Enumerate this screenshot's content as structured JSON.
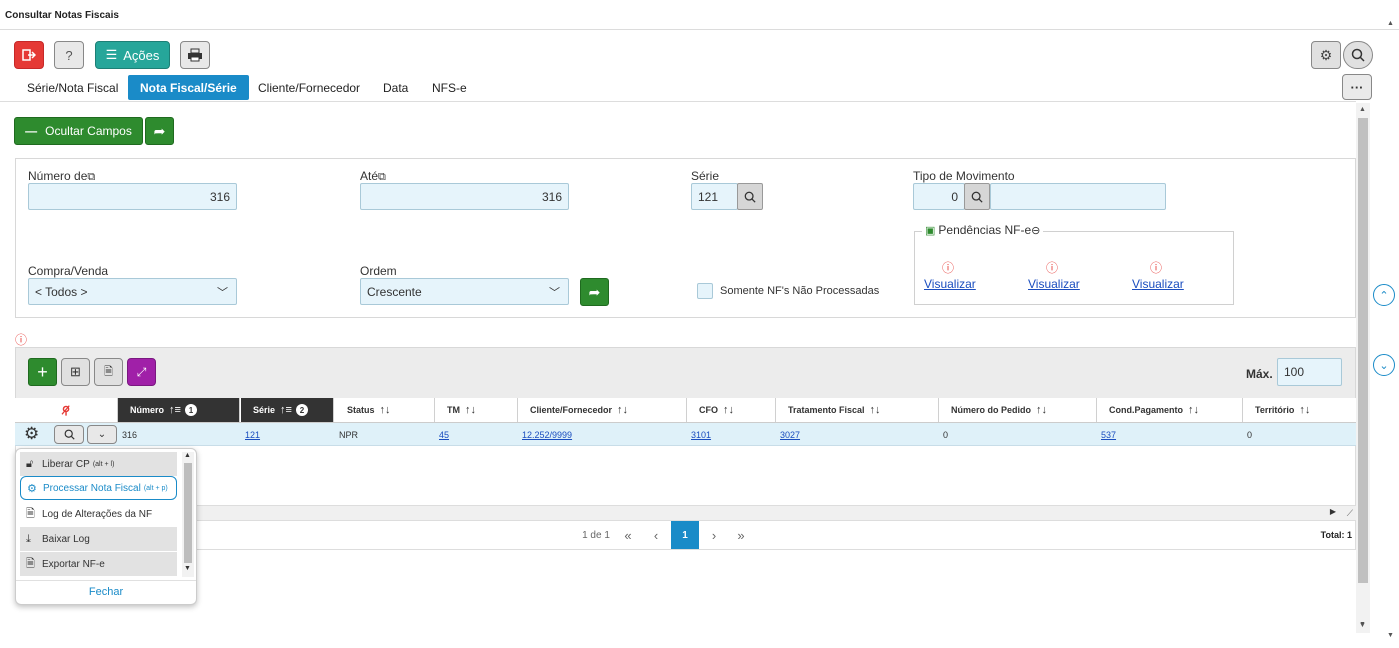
{
  "window": {
    "title": "Consultar Notas Fiscais"
  },
  "toolbar": {
    "exit_icon": "exit-icon",
    "help_label": "?",
    "actions_label": "Ações",
    "printer_icon": "printer-icon",
    "settings_icon": "gear-icon",
    "search_icon": "search-icon",
    "more_label": "···"
  },
  "tabs": [
    {
      "label": "Série/Nota Fiscal"
    },
    {
      "label": "Nota Fiscal/Série",
      "active": true
    },
    {
      "label": "Cliente/Fornecedor"
    },
    {
      "label": "Data"
    },
    {
      "label": "NFS-e"
    }
  ],
  "filters": {
    "hide_fields_label": "Ocultar Campos",
    "numero_de_label": "Número de",
    "numero_de_value": "316",
    "ate_label": "Até",
    "ate_value": "316",
    "serie_label": "Série",
    "serie_value": "121",
    "tipo_mov_label": "Tipo de Movimento",
    "tipo_mov_value": "0",
    "compra_venda_label": "Compra/Venda",
    "compra_venda_value": "< Todos >",
    "ordem_label": "Ordem",
    "ordem_value": "Crescente",
    "somente_label": "Somente NF's Não Processadas",
    "pendencias_label": "Pendências NF-e",
    "visualizar": [
      "Visualizar",
      "Visualizar",
      "Visualizar"
    ]
  },
  "grid": {
    "max_label": "Máx.",
    "max_value": "100",
    "columns": [
      {
        "label": "Número",
        "badge": "1"
      },
      {
        "label": "Série",
        "badge": "2"
      },
      {
        "label": "Status"
      },
      {
        "label": "TM"
      },
      {
        "label": "Cliente/Fornecedor"
      },
      {
        "label": "CFO"
      },
      {
        "label": "Tratamento Fiscal"
      },
      {
        "label": "Número do Pedido"
      },
      {
        "label": "Cond.Pagamento"
      },
      {
        "label": "Território"
      }
    ],
    "row": {
      "numero": "316",
      "serie": "121",
      "status": "NPR",
      "tm": "45",
      "cliente": "12.252/9999",
      "cfo": "3101",
      "tratamento": "3027",
      "pedido": "0",
      "cond_pagamento": "537",
      "territorio": "0"
    },
    "pagination": {
      "info": "1 de 1",
      "current": "1",
      "total": "Total: 1"
    }
  },
  "context_menu": {
    "items": [
      {
        "label": "Liberar CP",
        "shortcut": "(alt + l)"
      },
      {
        "label": "Processar Nota Fiscal",
        "shortcut": "(alt + p)"
      },
      {
        "label": "Log de Alterações da NF",
        "shortcut": ""
      },
      {
        "label": "Baixar Log",
        "shortcut": ""
      },
      {
        "label": "Exportar NF-e",
        "shortcut": ""
      }
    ],
    "close_label": "Fechar"
  },
  "colors": {
    "accent": "#1a8bc8",
    "green": "#2e8b2e",
    "danger": "#e53935",
    "teal": "#26a69a",
    "purple": "#a020a8"
  }
}
